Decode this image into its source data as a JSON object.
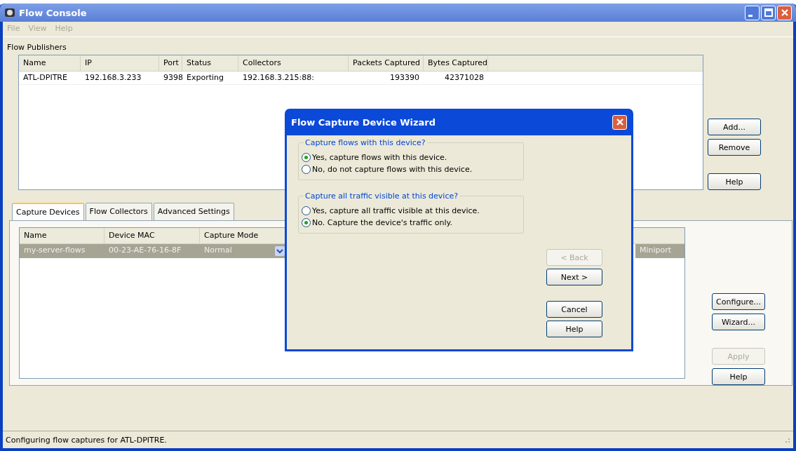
{
  "window": {
    "title": "Flow Console"
  },
  "menu": [
    {
      "label": "File",
      "disabled": true
    },
    {
      "label": "View",
      "disabled": true
    },
    {
      "label": "Help",
      "disabled": true
    }
  ],
  "publishers": {
    "label": "Flow Publishers",
    "columns": [
      "Name",
      "IP",
      "Port",
      "Status",
      "Collectors",
      "Packets Captured",
      "Bytes Captured"
    ],
    "rows": [
      {
        "selected": false,
        "cells": [
          "ATL-DPITRE",
          "192.168.3.233",
          "9398",
          "Exporting",
          "192.168.3.215:88:",
          "193390",
          "42371028"
        ]
      }
    ],
    "buttons": [
      {
        "label": "Add...",
        "disabled": false
      },
      {
        "label": "Remove",
        "disabled": false
      },
      {
        "label": "Help",
        "disabled": false
      }
    ]
  },
  "tabs": [
    {
      "label": "Capture Devices",
      "selected": true
    },
    {
      "label": "Flow Collectors",
      "selected": false
    },
    {
      "label": "Advanced Settings",
      "selected": false
    }
  ],
  "capture_devices": {
    "columns": [
      "Name",
      "Device MAC",
      "Capture Mode"
    ],
    "rows": [
      {
        "selected": true,
        "name": "my-server-flows",
        "mac": "00-23-AE-76-16-8F",
        "mode": "Normal",
        "column_4": "Miniport"
      }
    ],
    "buttons": [
      {
        "label": "Configure...",
        "disabled": false
      },
      {
        "label": "Wizard...",
        "disabled": false
      },
      {
        "label": "Apply",
        "disabled": true
      },
      {
        "label": "Help",
        "disabled": false
      }
    ]
  },
  "dialog": {
    "title": "Flow Capture Device Wizard",
    "groups": [
      {
        "title": "Capture flows with this device?",
        "options": [
          {
            "label": "Yes, capture flows with this device.",
            "selected": true
          },
          {
            "label": "No, do not capture flows with this device.",
            "selected": false
          }
        ]
      },
      {
        "title": "Capture all traffic visible at this device?",
        "options": [
          {
            "label": "Yes, capture all traffic visible at this device.",
            "selected": false
          },
          {
            "label": "No. Capture the device's traffic only.",
            "selected": true
          }
        ]
      }
    ],
    "buttons": [
      {
        "label": "< Back",
        "disabled": true
      },
      {
        "label": "Next >",
        "disabled": false
      },
      {
        "label": "Cancel",
        "disabled": false
      },
      {
        "label": "Help",
        "disabled": false
      }
    ]
  },
  "status_bar": "Configuring flow captures for ATL-DPITRE."
}
